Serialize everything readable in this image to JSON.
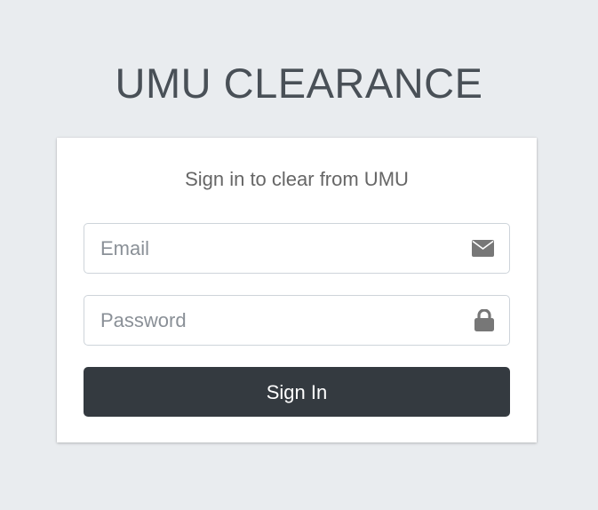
{
  "logo": {
    "text": "UMU CLEARANCE"
  },
  "login": {
    "message": "Sign in to clear from UMU",
    "email": {
      "placeholder": "Email",
      "value": "",
      "icon": "envelope-icon"
    },
    "password": {
      "placeholder": "Password",
      "value": "",
      "icon": "lock-icon"
    },
    "submit_label": "Sign In"
  },
  "colors": {
    "background": "#e9ecef",
    "button": "#343a40",
    "icon": "#777777",
    "title": "#495057"
  }
}
